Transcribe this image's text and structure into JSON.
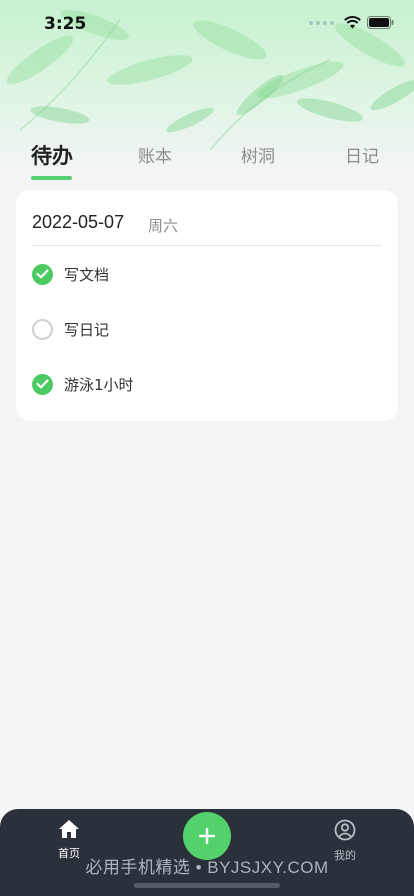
{
  "status_bar": {
    "time": "3:25",
    "signal_icon": "cellular-dots-icon",
    "wifi_icon": "wifi-icon",
    "battery_icon": "battery-icon"
  },
  "tabs": [
    {
      "label": "待办",
      "active": true
    },
    {
      "label": "账本",
      "active": false
    },
    {
      "label": "树洞",
      "active": false
    },
    {
      "label": "日记",
      "active": false
    }
  ],
  "card": {
    "date": "2022-05-07",
    "weekday": "周六",
    "todos": [
      {
        "label": "写文档",
        "done": true
      },
      {
        "label": "写日记",
        "done": false
      },
      {
        "label": "游泳1小时",
        "done": true
      }
    ]
  },
  "bottom_nav": {
    "home_label": "首页",
    "mine_label": "我的",
    "add_icon": "plus-icon"
  },
  "watermark": "必用手机精选 • BYJSJXY.COM",
  "colors": {
    "accent": "#5bd073",
    "check_done": "#4cca62",
    "bottom_bar": "#2b313a",
    "background": "#f3f4f6"
  }
}
